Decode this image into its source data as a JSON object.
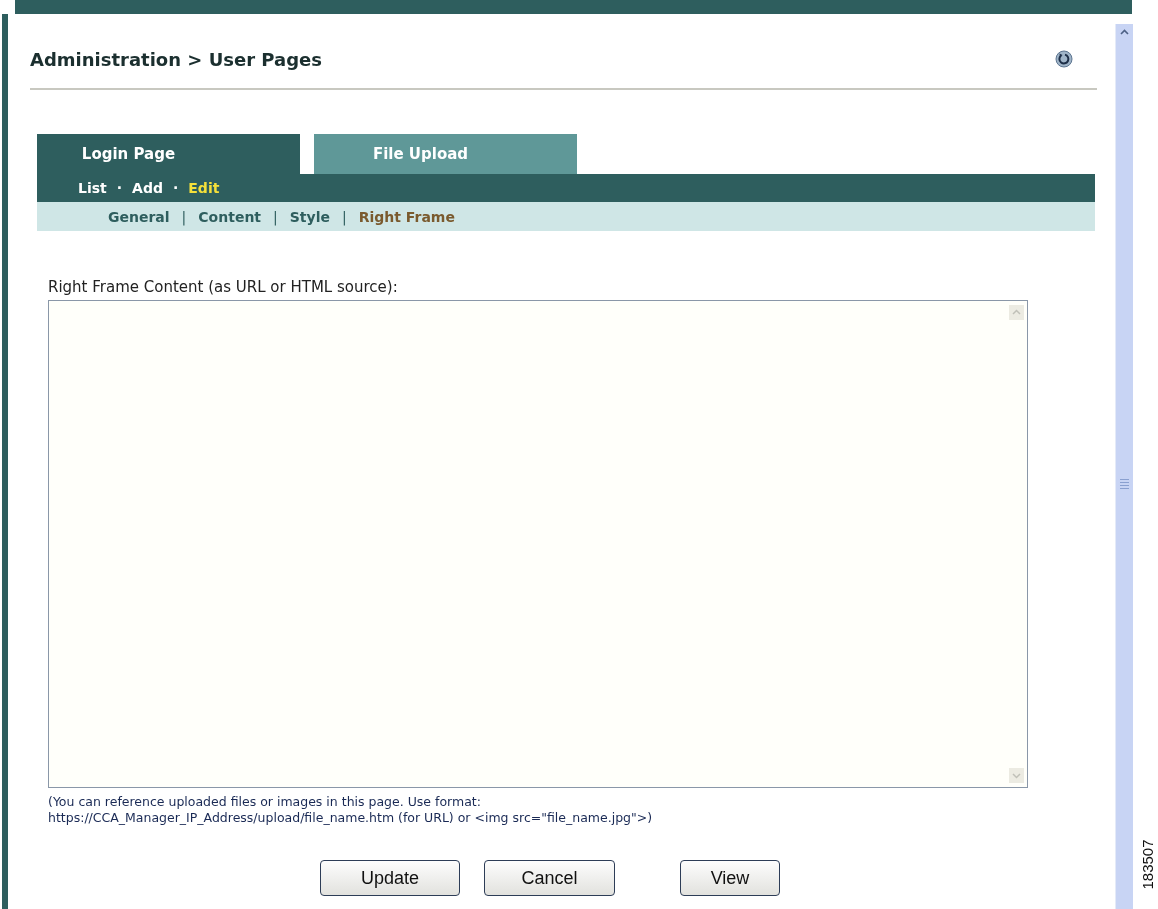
{
  "breadcrumb": {
    "title": "Administration > User Pages"
  },
  "tabs": [
    {
      "label": "Login Page",
      "selected": true
    },
    {
      "label": "File Upload",
      "selected": false
    }
  ],
  "action_nav": {
    "separator": "·",
    "items": [
      {
        "label": "List",
        "selected": false
      },
      {
        "label": "Add",
        "selected": false
      },
      {
        "label": "Edit",
        "selected": true
      }
    ]
  },
  "section_nav": {
    "separator": "|",
    "items": [
      {
        "label": "General",
        "selected": false
      },
      {
        "label": "Content",
        "selected": false
      },
      {
        "label": "Style",
        "selected": false
      },
      {
        "label": "Right Frame",
        "selected": true
      }
    ]
  },
  "right_frame": {
    "label": "Right Frame Content (as URL or HTML source):",
    "help_lines": [
      "(You can reference uploaded files or images in this page. Use format:",
      "https://CCA_Manager_IP_Address/upload/file_name.htm (for URL) or <img src=\"file_name.jpg\">)"
    ]
  },
  "buttons": [
    {
      "label": "Update"
    },
    {
      "label": "Cancel"
    },
    {
      "label": "View"
    }
  ],
  "figure_id": "183507"
}
